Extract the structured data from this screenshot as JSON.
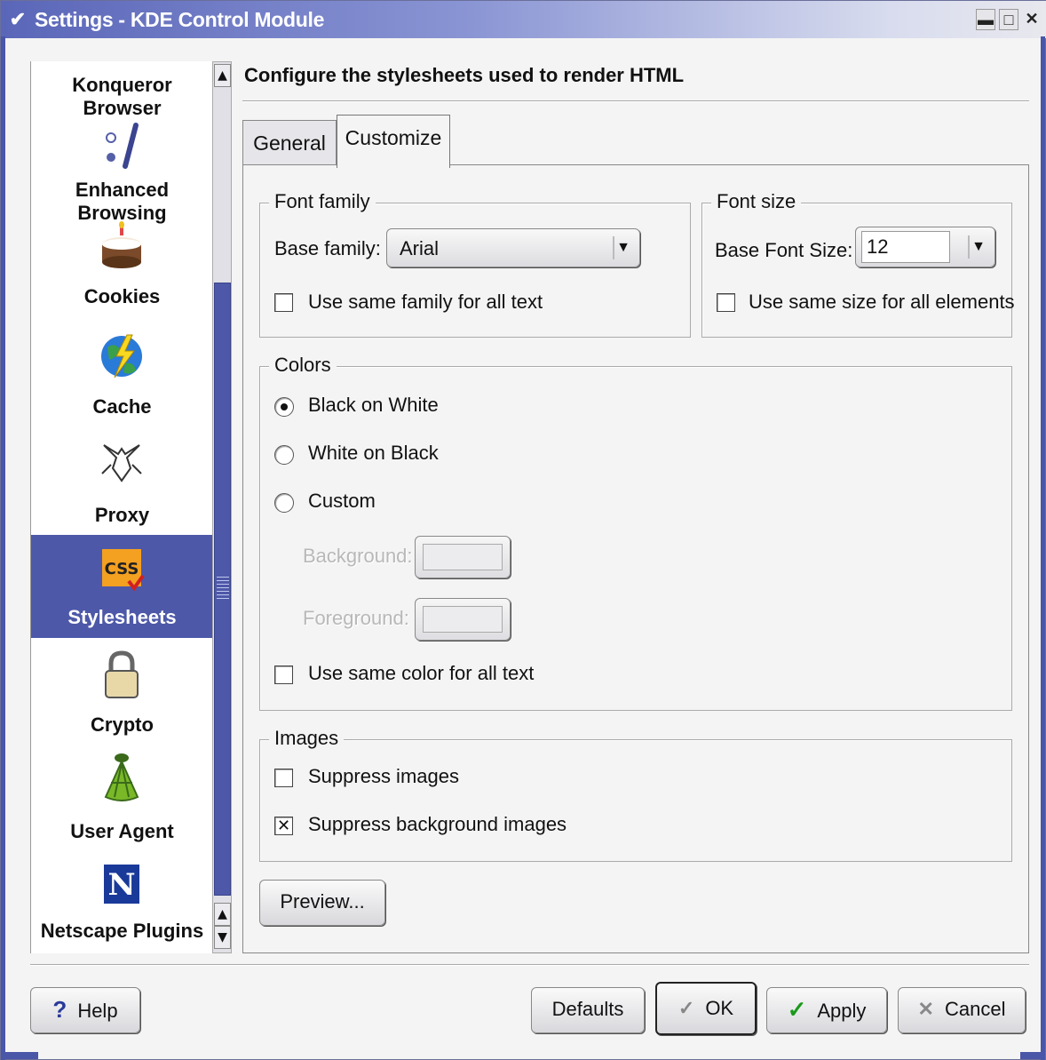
{
  "window": {
    "title": "Settings - KDE Control Module",
    "controls": {
      "minimize": "▬",
      "maximize": "□",
      "close": "✕"
    }
  },
  "sidebar": {
    "items": [
      {
        "label": "Konqueror Browser",
        "icon": "konqueror-icon"
      },
      {
        "label": "Enhanced Browsing",
        "icon": "enhanced-browsing-icon"
      },
      {
        "label": "Cookies",
        "icon": "cookie-cake-icon"
      },
      {
        "label": "Cache",
        "icon": "cache-globe-icon"
      },
      {
        "label": "Proxy",
        "icon": "proxy-icon"
      },
      {
        "label": "Stylesheets",
        "icon": "css-icon",
        "selected": true,
        "icon_text": "CSS"
      },
      {
        "label": "Crypto",
        "icon": "padlock-icon"
      },
      {
        "label": "User Agent",
        "icon": "user-agent-icon"
      },
      {
        "label": "Netscape Plugins",
        "icon": "netscape-icon",
        "icon_text": "N"
      }
    ]
  },
  "header": {
    "title": "Configure the stylesheets used to render HTML"
  },
  "tabs": [
    {
      "label": "General",
      "active": false
    },
    {
      "label": "Customize",
      "active": true
    }
  ],
  "font_family": {
    "group_label": "Font family",
    "base_label": "Base family:",
    "base_value": "Arial",
    "same_family_label": "Use same family for all text",
    "same_family_checked": false
  },
  "font_size": {
    "group_label": "Font size",
    "base_label": "Base Font Size:",
    "base_value": "12",
    "same_size_label": "Use same size for all elements",
    "same_size_checked": false
  },
  "colors": {
    "group_label": "Colors",
    "options": [
      {
        "label": "Black on White",
        "selected": true
      },
      {
        "label": "White on Black",
        "selected": false
      },
      {
        "label": "Custom",
        "selected": false
      }
    ],
    "background_label": "Background:",
    "foreground_label": "Foreground:",
    "same_color_label": "Use same color for all text",
    "same_color_checked": false
  },
  "images": {
    "group_label": "Images",
    "suppress_images_label": "Suppress images",
    "suppress_images_checked": false,
    "suppress_bg_label": "Suppress background images",
    "suppress_bg_checked": true,
    "check_mark": "✕"
  },
  "preview_button": "Preview...",
  "buttons": {
    "help": "Help",
    "defaults": "Defaults",
    "ok": "OK",
    "apply": "Apply",
    "cancel": "Cancel"
  },
  "colors_theme": {
    "selection": "#4d58a8",
    "titlebar_start": "#5a66b8",
    "apply_check": "#1a9a1a"
  }
}
